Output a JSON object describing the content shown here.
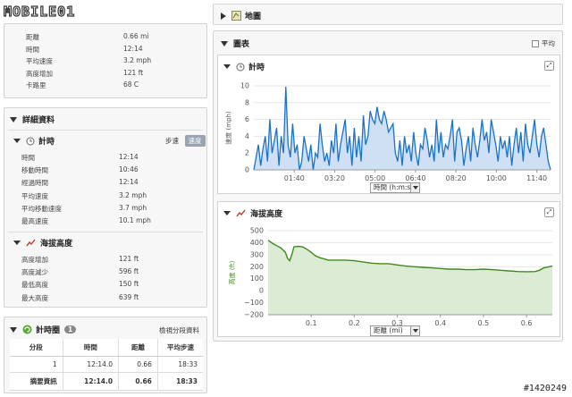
{
  "logo": {
    "text": "MOBILE01"
  },
  "watermark": "#1420249",
  "summary": {
    "rows": [
      {
        "label": "距離",
        "value": "0.66 mi"
      },
      {
        "label": "時間",
        "value": "12:14"
      },
      {
        "label": "平均速度",
        "value": "3.2 mph"
      },
      {
        "label": "高度增加",
        "value": "121 ft"
      },
      {
        "label": "卡路里",
        "value": "68 C"
      }
    ]
  },
  "details": {
    "title": "詳細資料",
    "timing": {
      "title": "計時",
      "tab_pace": "步速",
      "tab_speed": "速度",
      "rows": [
        {
          "label": "時間",
          "value": "12:14"
        },
        {
          "label": "移動時間",
          "value": "10:46"
        },
        {
          "label": "經過時間",
          "value": "12:14"
        },
        {
          "label": "平均速度",
          "value": "3.2 mph"
        },
        {
          "label": "平均移動速度",
          "value": "3.7 mph"
        },
        {
          "label": "最高速度",
          "value": "10.1 mph"
        }
      ]
    },
    "elevation": {
      "title": "海拔高度",
      "rows": [
        {
          "label": "高度增加",
          "value": "121 ft"
        },
        {
          "label": "高度減少",
          "value": "596 ft"
        },
        {
          "label": "最低高度",
          "value": "150 ft"
        },
        {
          "label": "最大高度",
          "value": "639 ft"
        }
      ]
    }
  },
  "laps": {
    "title": "計時圈",
    "count": "1",
    "view_link": "檢視分段資料",
    "headers": [
      "分段",
      "時間",
      "距離",
      "平均步速"
    ],
    "rows": [
      [
        "1",
        "12:14.0",
        "0.66",
        "18:33"
      ]
    ],
    "summary_row": [
      "摘要資訊",
      "12:14.0",
      "0.66",
      "18:33"
    ]
  },
  "map": {
    "title": "地圖"
  },
  "charts_panel": {
    "title": "圖表",
    "average_label": "平均"
  },
  "chart_data": [
    {
      "type": "area",
      "title": "計時",
      "ylabel": "速度 (mph)",
      "xlabel": "時間 (h:m:s)",
      "ylim": [
        0,
        10
      ],
      "yticks": [
        "0",
        "2",
        "4",
        "6",
        "8",
        "10"
      ],
      "xticks": [
        "01:40",
        "03:20",
        "05:00",
        "06:40",
        "08:20",
        "10:00",
        "11:40"
      ],
      "x_range_seconds": [
        0,
        734
      ],
      "color": "#1a73c8",
      "fill": "#cfe0f5",
      "values": [
        0,
        1.5,
        3,
        0.5,
        2.5,
        4,
        1,
        6,
        2,
        3.5,
        5,
        0.5,
        4,
        2,
        9.9,
        3,
        1.5,
        5.5,
        2,
        3,
        0,
        1,
        4,
        2.5,
        1,
        3,
        0,
        2,
        1.5,
        5.5,
        3,
        1,
        2,
        0.5,
        3.5,
        2,
        5.5,
        1,
        3,
        4.5,
        6,
        2,
        4,
        0.5,
        5,
        1.5,
        4,
        1,
        6.5,
        3,
        4,
        7,
        6,
        5.5,
        7.5,
        6,
        5.5,
        7,
        6,
        4.5,
        5,
        5.5,
        2,
        1,
        3.5,
        0.5,
        4,
        2,
        3,
        1,
        4.5,
        2,
        0.5,
        3,
        2.5,
        5,
        3.5,
        1.5,
        3,
        1,
        6,
        2,
        4.5,
        1.5,
        3,
        2.5,
        4,
        6,
        1,
        4.5,
        5,
        3.5,
        0.5,
        2.5,
        4,
        1,
        5,
        3,
        1.5,
        3.5,
        6,
        3.5,
        4.5,
        2,
        6,
        4.5,
        3,
        1,
        4,
        2.5,
        3.5,
        1.5,
        4,
        0.5,
        3,
        5,
        2,
        4.5,
        1,
        5.5,
        3,
        2,
        4,
        6,
        3,
        1.5,
        4,
        5,
        3,
        1,
        0
      ]
    },
    {
      "type": "area",
      "title": "海拔高度",
      "ylabel": "高度 (ft)",
      "xlabel": "距離 (mi)",
      "ylim": [
        -200,
        500
      ],
      "yticks": [
        "500",
        "400",
        "300",
        "200",
        "100",
        "0",
        "−100",
        "−200"
      ],
      "xticks": [
        "0.1",
        "0.2",
        "0.3",
        "0.4",
        "0.5",
        "0.6"
      ],
      "x_range": [
        0,
        0.66
      ],
      "color": "#3f8a1e",
      "fill": "#dcebd3",
      "points": [
        [
          0,
          420
        ],
        [
          0.01,
          395
        ],
        [
          0.02,
          375
        ],
        [
          0.03,
          355
        ],
        [
          0.04,
          320
        ],
        [
          0.045,
          270
        ],
        [
          0.05,
          250
        ],
        [
          0.055,
          300
        ],
        [
          0.06,
          365
        ],
        [
          0.07,
          370
        ],
        [
          0.08,
          365
        ],
        [
          0.09,
          345
        ],
        [
          0.1,
          320
        ],
        [
          0.11,
          290
        ],
        [
          0.12,
          275
        ],
        [
          0.13,
          265
        ],
        [
          0.14,
          255
        ],
        [
          0.16,
          255
        ],
        [
          0.18,
          255
        ],
        [
          0.2,
          250
        ],
        [
          0.22,
          240
        ],
        [
          0.24,
          230
        ],
        [
          0.26,
          225
        ],
        [
          0.28,
          225
        ],
        [
          0.3,
          215
        ],
        [
          0.32,
          205
        ],
        [
          0.34,
          200
        ],
        [
          0.36,
          195
        ],
        [
          0.38,
          190
        ],
        [
          0.4,
          185
        ],
        [
          0.42,
          180
        ],
        [
          0.44,
          180
        ],
        [
          0.46,
          175
        ],
        [
          0.48,
          175
        ],
        [
          0.5,
          180
        ],
        [
          0.52,
          175
        ],
        [
          0.54,
          170
        ],
        [
          0.56,
          165
        ],
        [
          0.58,
          160
        ],
        [
          0.6,
          158
        ],
        [
          0.62,
          160
        ],
        [
          0.63,
          170
        ],
        [
          0.64,
          190
        ],
        [
          0.66,
          205
        ]
      ]
    }
  ]
}
